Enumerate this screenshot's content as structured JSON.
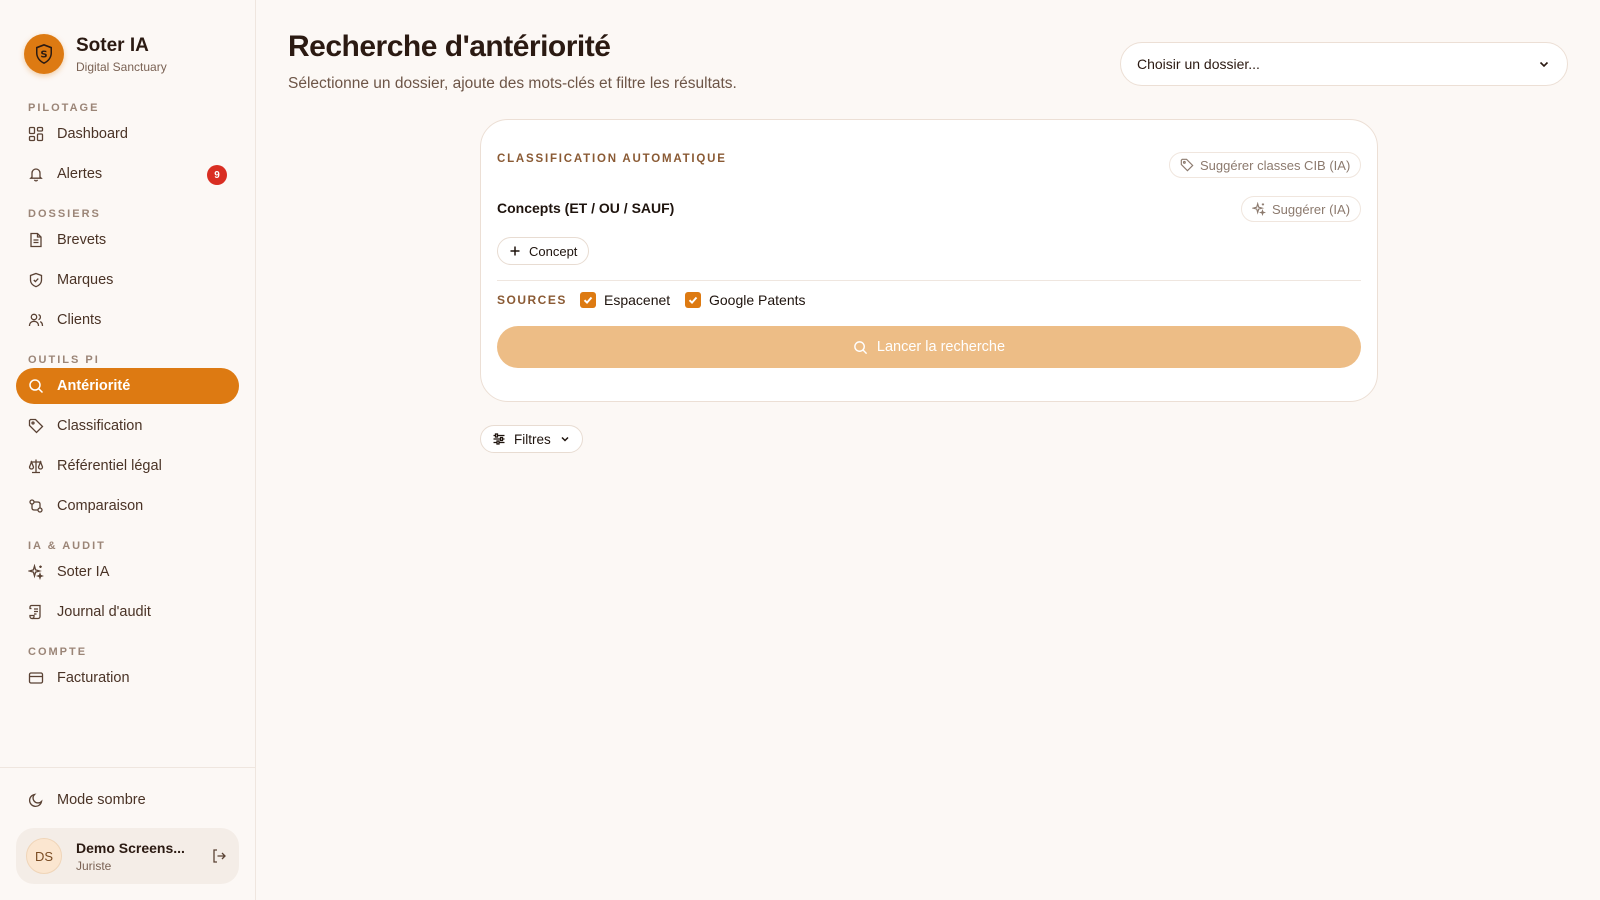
{
  "brand": {
    "title": "Soter IA",
    "subtitle": "Digital Sanctuary"
  },
  "sidebar": {
    "sections": {
      "pilotage": "PILOTAGE",
      "dossiers": "DOSSIERS",
      "outils": "OUTILS PI",
      "ia_audit": "IA & AUDIT",
      "compte": "COMPTE"
    },
    "items": {
      "dashboard": "Dashboard",
      "alertes": "Alertes",
      "alertes_badge": "9",
      "brevets": "Brevets",
      "marques": "Marques",
      "clients": "Clients",
      "anteriorite": "Antériorité",
      "classification": "Classification",
      "referentiel": "Référentiel légal",
      "comparaison": "Comparaison",
      "soter_ia": "Soter IA",
      "journal": "Journal d'audit",
      "facturation": "Facturation"
    },
    "dark_mode": "Mode sombre",
    "user": {
      "initials": "DS",
      "name": "Demo Screens...",
      "role": "Juriste"
    }
  },
  "header": {
    "title": "Recherche d'antériorité",
    "subtitle": "Sélectionne un dossier, ajoute des mots-clés et filtre les résultats.",
    "dossier_select": "Choisir un dossier..."
  },
  "card": {
    "classification_label": "CLASSIFICATION AUTOMATIQUE",
    "suggest_cib": "Suggérer classes CIB (IA)",
    "concepts_label": "Concepts (ET / OU / SAUF)",
    "suggest_ia": "Suggérer (IA)",
    "add_concept": "Concept",
    "sources_label": "SOURCES",
    "sources": [
      {
        "label": "Espacenet",
        "checked": true
      },
      {
        "label": "Google Patents",
        "checked": true
      }
    ],
    "search_button": "Lancer la recherche"
  },
  "filters": {
    "label": "Filtres"
  },
  "colors": {
    "accent": "#dd7a12",
    "badge": "#d92e22",
    "search_button_disabled": "#edbd86"
  }
}
